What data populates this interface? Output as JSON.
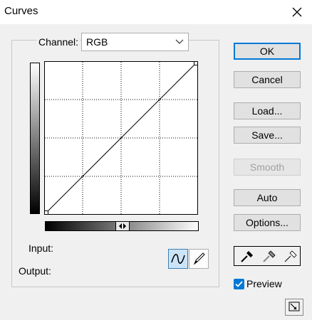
{
  "window": {
    "title": "Curves"
  },
  "channel": {
    "label": "Channel:",
    "value": "RGB"
  },
  "labels": {
    "input": "Input:",
    "output": "Output:"
  },
  "buttons": {
    "ok": "OK",
    "cancel": "Cancel",
    "load": "Load...",
    "save": "Save...",
    "smooth": "Smooth",
    "auto": "Auto",
    "options": "Options..."
  },
  "preview": {
    "label": "Preview",
    "checked": true
  },
  "tools": {
    "active": "curve-tool",
    "items": [
      "curve-tool",
      "pencil-tool"
    ]
  },
  "eyedroppers": [
    "black-point-eyedropper-icon",
    "gray-point-eyedropper-icon",
    "white-point-eyedropper-icon"
  ],
  "curve": {
    "points": [
      [
        0,
        0
      ],
      [
        255,
        255
      ]
    ]
  },
  "colors": {
    "accent": "#0078d7",
    "active_tool_bg": "#cce4f7",
    "dialog_bg": "#f0f0f0"
  }
}
